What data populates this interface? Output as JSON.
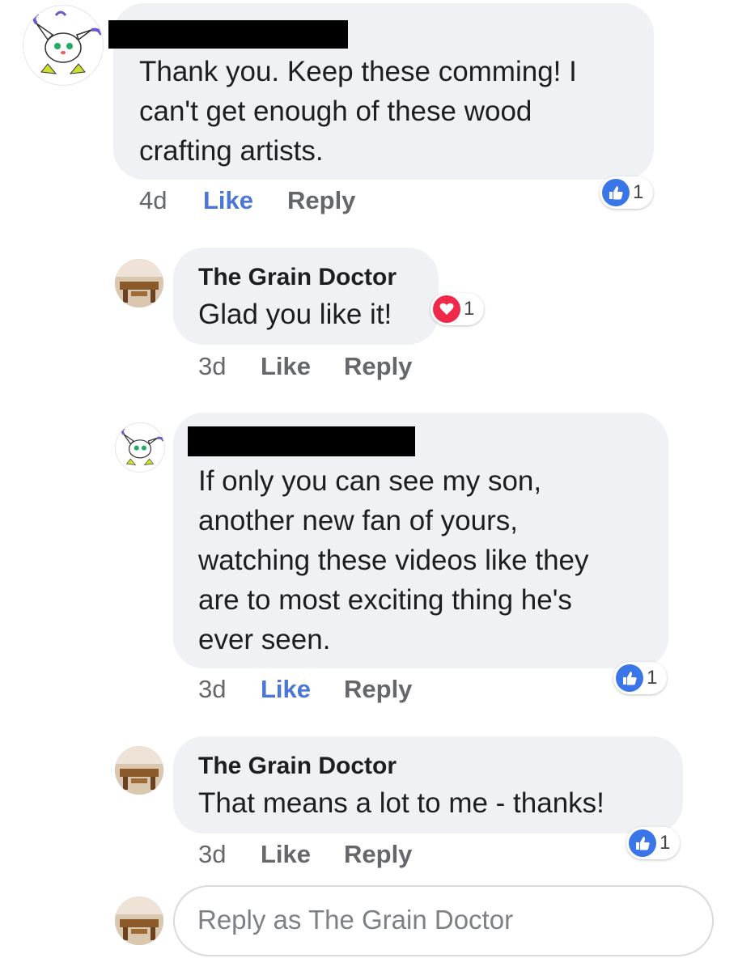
{
  "comments": [
    {
      "author": "",
      "author_redacted": true,
      "text_lines": [
        "Thank you. Keep these comming! I",
        "can't get enough of these wood",
        "crafting artists."
      ],
      "time": "4d",
      "like_label": "Like",
      "reply_label": "Reply",
      "liked": true,
      "reaction": {
        "type": "like",
        "count": "1"
      }
    },
    {
      "author": "The Grain Doctor",
      "author_redacted": false,
      "text_lines": [
        "Glad you like it!"
      ],
      "time": "3d",
      "like_label": "Like",
      "reply_label": "Reply",
      "liked": false,
      "reaction": {
        "type": "love",
        "count": "1"
      }
    },
    {
      "author": "",
      "author_redacted": true,
      "text_lines": [
        "If only you can see my son,",
        "another new fan of yours,",
        "watching these videos like they",
        "are to most exciting thing he's",
        "ever seen."
      ],
      "time": "3d",
      "like_label": "Like",
      "reply_label": "Reply",
      "liked": true,
      "reaction": {
        "type": "like",
        "count": "1"
      }
    },
    {
      "author": "The Grain Doctor",
      "author_redacted": false,
      "text_lines": [
        "That means a lot to me - thanks!"
      ],
      "time": "3d",
      "like_label": "Like",
      "reply_label": "Reply",
      "liked": false,
      "reaction": {
        "type": "like",
        "count": "1"
      }
    }
  ],
  "reply_box": {
    "placeholder": "Reply as The Grain Doctor"
  },
  "colors": {
    "like_blue": "#4b76d6",
    "bubble": "#f0f1f4",
    "meta_gray": "#65676b",
    "love_red": "#f0284a"
  }
}
